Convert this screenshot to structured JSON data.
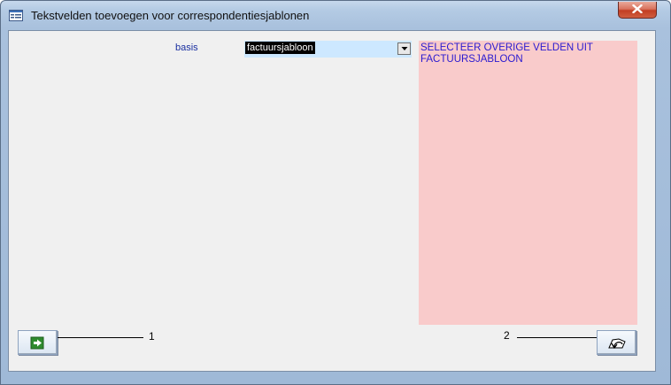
{
  "window": {
    "title": "Tekstvelden toevoegen voor correspondentiesjablonen"
  },
  "form": {
    "basis_label": "basis",
    "basis_value": "factuursjabloon",
    "info_text": "SELECTEER OVERIGE VELDEN UIT FACTUURSJABLOON"
  },
  "footer": {
    "label_1": "1",
    "label_2": "2"
  },
  "icons": {
    "window": "form-icon",
    "close": "close-icon",
    "dropdown": "chevron-down-icon",
    "next": "arrow-right-icon",
    "undo": "undo-icon"
  },
  "colors": {
    "label_text": "#1a2fa0",
    "combo_background": "#cde8ff",
    "info_background": "#f9cbcb",
    "info_text": "#2a1ad0",
    "close_button": "#c23e22",
    "next_icon": "#2e8b2e"
  }
}
